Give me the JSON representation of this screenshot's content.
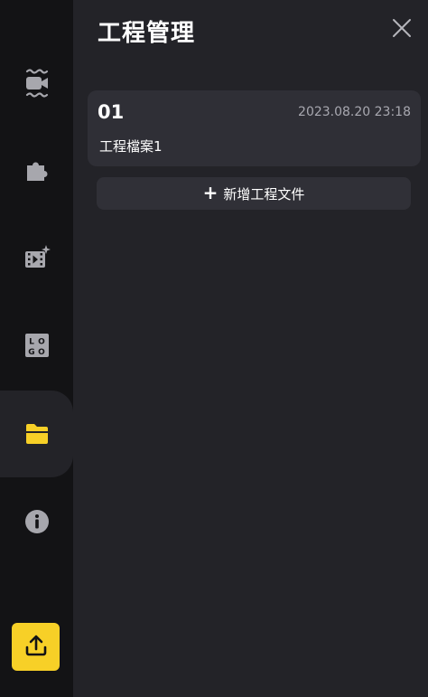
{
  "sidebar": {
    "items": [
      {
        "name": "water-video-icon",
        "active": false
      },
      {
        "name": "puzzle-icon",
        "active": false
      },
      {
        "name": "video-effects-icon",
        "active": false
      },
      {
        "name": "logo-icon",
        "active": false,
        "logo_letters": [
          "L",
          "O",
          "G",
          "O"
        ]
      },
      {
        "name": "project-folder-icon",
        "active": true
      },
      {
        "name": "info-icon",
        "active": false
      }
    ],
    "upload_icon": "upload-icon"
  },
  "panel": {
    "title": "工程管理",
    "close_icon": "close-icon",
    "projects": [
      {
        "index": "01",
        "date": "2023.08.20 23:18",
        "name": "工程檔案1"
      }
    ],
    "add_button": {
      "plus": "+",
      "label": "新增工程文件"
    }
  },
  "colors": {
    "accent": "#f7d027",
    "sidebar_bg": "#131315",
    "panel_bg": "#232328",
    "card_bg": "#2f2f36",
    "icon_gray": "#a7a7ad",
    "secondary_text": "#a8a8b0"
  }
}
